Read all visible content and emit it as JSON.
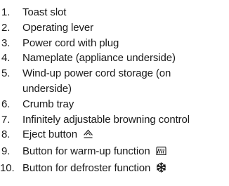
{
  "parts": [
    {
      "number": "1.",
      "label": "Toast slot"
    },
    {
      "number": "2.",
      "label": "Operating lever"
    },
    {
      "number": "3.",
      "label": "Power cord with plug"
    },
    {
      "number": "4.",
      "label": "Nameplate (appliance underside)"
    },
    {
      "number": "5.",
      "label": "Wind-up power cord storage (on",
      "label_cont": "underside)"
    },
    {
      "number": "6.",
      "label": "Crumb tray"
    },
    {
      "number": "7.",
      "label": "Infinitely adjustable browning control"
    },
    {
      "number": "8.",
      "label": "Eject button",
      "icon": "eject-symbol-icon"
    },
    {
      "number": "9.",
      "label": "Button for warm-up function",
      "icon": "warm-up-symbol-icon"
    },
    {
      "number": "10.",
      "label": "Button for defroster function",
      "icon": "defrost-snowflake-icon"
    }
  ]
}
